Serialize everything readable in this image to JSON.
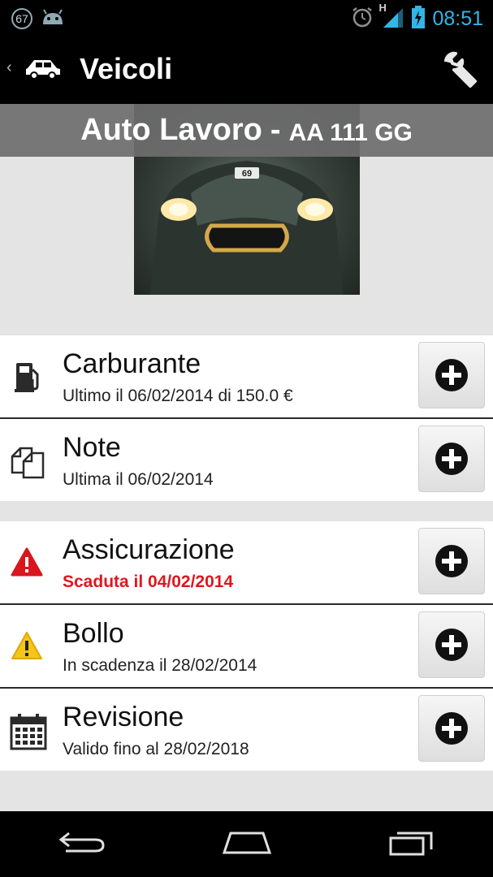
{
  "status_bar": {
    "notification_count": "67",
    "network_type": "H",
    "time": "08:51"
  },
  "action_bar": {
    "title": "Veicoli",
    "icons": {
      "up": "chevron-left-icon",
      "app": "car-icon",
      "settings": "wrench-icon"
    }
  },
  "vehicle": {
    "name": "Auto Lavoro",
    "separator": "-",
    "plate": "AA 111 GG",
    "badge_number": "69"
  },
  "items": [
    {
      "id": "fuel",
      "icon": "fuel-pump-icon",
      "title": "Carburante",
      "subtitle": "Ultimo il 06/02/2014 di 150.0 €",
      "status": "normal"
    },
    {
      "id": "notes",
      "icon": "notes-icon",
      "title": "Note",
      "subtitle": "Ultima il 06/02/2014",
      "status": "normal"
    },
    {
      "id": "insurance",
      "icon": "error-triangle-icon",
      "title": "Assicurazione",
      "subtitle": "Scaduta il 04/02/2014",
      "status": "expired"
    },
    {
      "id": "tax",
      "icon": "warning-triangle-icon",
      "title": "Bollo",
      "subtitle": "In scadenza il 28/02/2014",
      "status": "warning"
    },
    {
      "id": "inspection",
      "icon": "calendar-icon",
      "title": "Revisione",
      "subtitle": "Valido fino al 28/02/2018",
      "status": "normal"
    }
  ],
  "colors": {
    "accent": "#33b5e5",
    "expired": "#e0161e",
    "warning": "#f5c518",
    "background": "#e4e4e4"
  },
  "nav_bar": {
    "icons": [
      "back-icon",
      "home-icon",
      "recent-apps-icon"
    ]
  }
}
